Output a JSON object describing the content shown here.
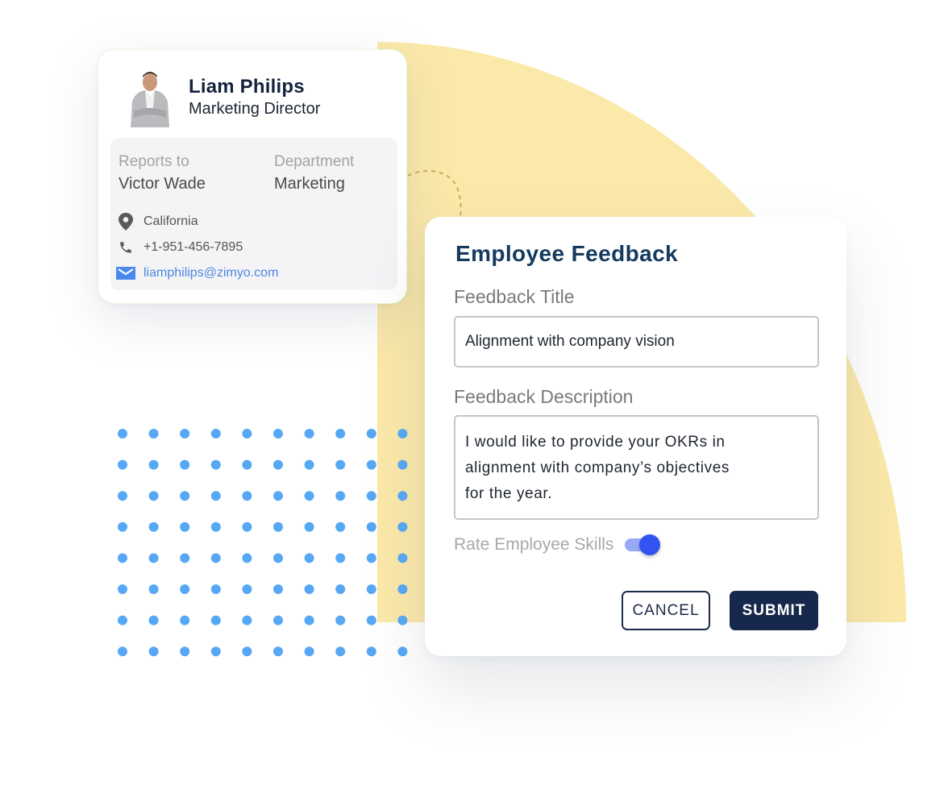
{
  "colors": {
    "background_shape": "#fbe9a9",
    "dots": "#56a8f5",
    "title": "#143a5e",
    "primary_button": "#16284c",
    "toggle_knob": "#3454f2",
    "toggle_track": "#98a9f6",
    "email_link": "#4d86e0"
  },
  "decor": {
    "dot_grid": {
      "columns": 10,
      "rows": 8
    }
  },
  "profile": {
    "avatar_icon": "person-photo",
    "name": "Liam Philips",
    "role": "Marketing Director",
    "reports_to_label": "Reports to",
    "reports_to_value": "Victor Wade",
    "department_label": "Department",
    "department_value": "Marketing",
    "contacts": [
      {
        "icon": "location-pin-icon",
        "text": "California"
      },
      {
        "icon": "phone-icon",
        "text": "+1-951-456-7895"
      },
      {
        "icon": "mail-icon",
        "text": "liamphilips@zimyo.com"
      }
    ]
  },
  "feedback": {
    "title": "Employee Feedback",
    "feedback_title_label": "Feedback Title",
    "feedback_title_value": "Alignment with company vision",
    "description_label": "Feedback Description",
    "description_value": "I would like to provide your OKRs in\nalignment with company’s objectives\nfor the year.",
    "rate_skills_label": "Rate Employee Skills",
    "rate_skills_enabled": true,
    "cancel_label": "CANCEL",
    "submit_label": "SUBMIT"
  }
}
